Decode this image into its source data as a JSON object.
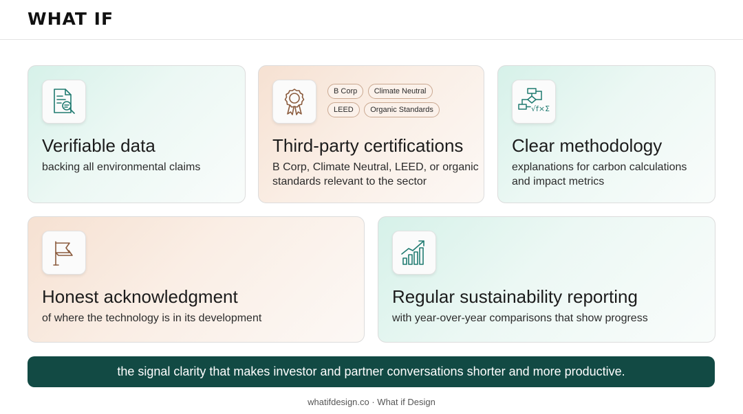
{
  "header": {
    "logo": "WHAT IF"
  },
  "cards": [
    {
      "icon": "document-search-icon",
      "title": "Verifiable data",
      "description": "backing all environmental claims"
    },
    {
      "icon": "award-ribbon-icon",
      "title": "Third-party certifications",
      "description": "B Corp, Climate Neutral, LEED, or organic standards relevant to the sector",
      "tags": [
        "B Corp",
        "Climate Neutral",
        "LEED",
        "Organic Standards"
      ]
    },
    {
      "icon": "flowchart-formula-icon",
      "title": "Clear methodology",
      "description": "explanations for carbon calculations and impact metrics"
    },
    {
      "icon": "flag-icon",
      "title": "Honest acknowledgment",
      "description": "of where the technology is in its development"
    },
    {
      "icon": "growth-chart-icon",
      "title": "Regular sustainability reporting",
      "description": "with year-over-year comparisons that show progress"
    }
  ],
  "banner": {
    "text": "the signal clarity that makes investor and partner conversations shorter and more productive."
  },
  "footer": {
    "text": "whatifdesign.co · What if Design"
  },
  "colors": {
    "accent_dark_green": "#124a44",
    "icon_teal": "#1f7a70",
    "icon_brown": "#8a5a3c",
    "mint_tint": "#d6f1e9",
    "peach_tint": "#f6e1d2"
  }
}
